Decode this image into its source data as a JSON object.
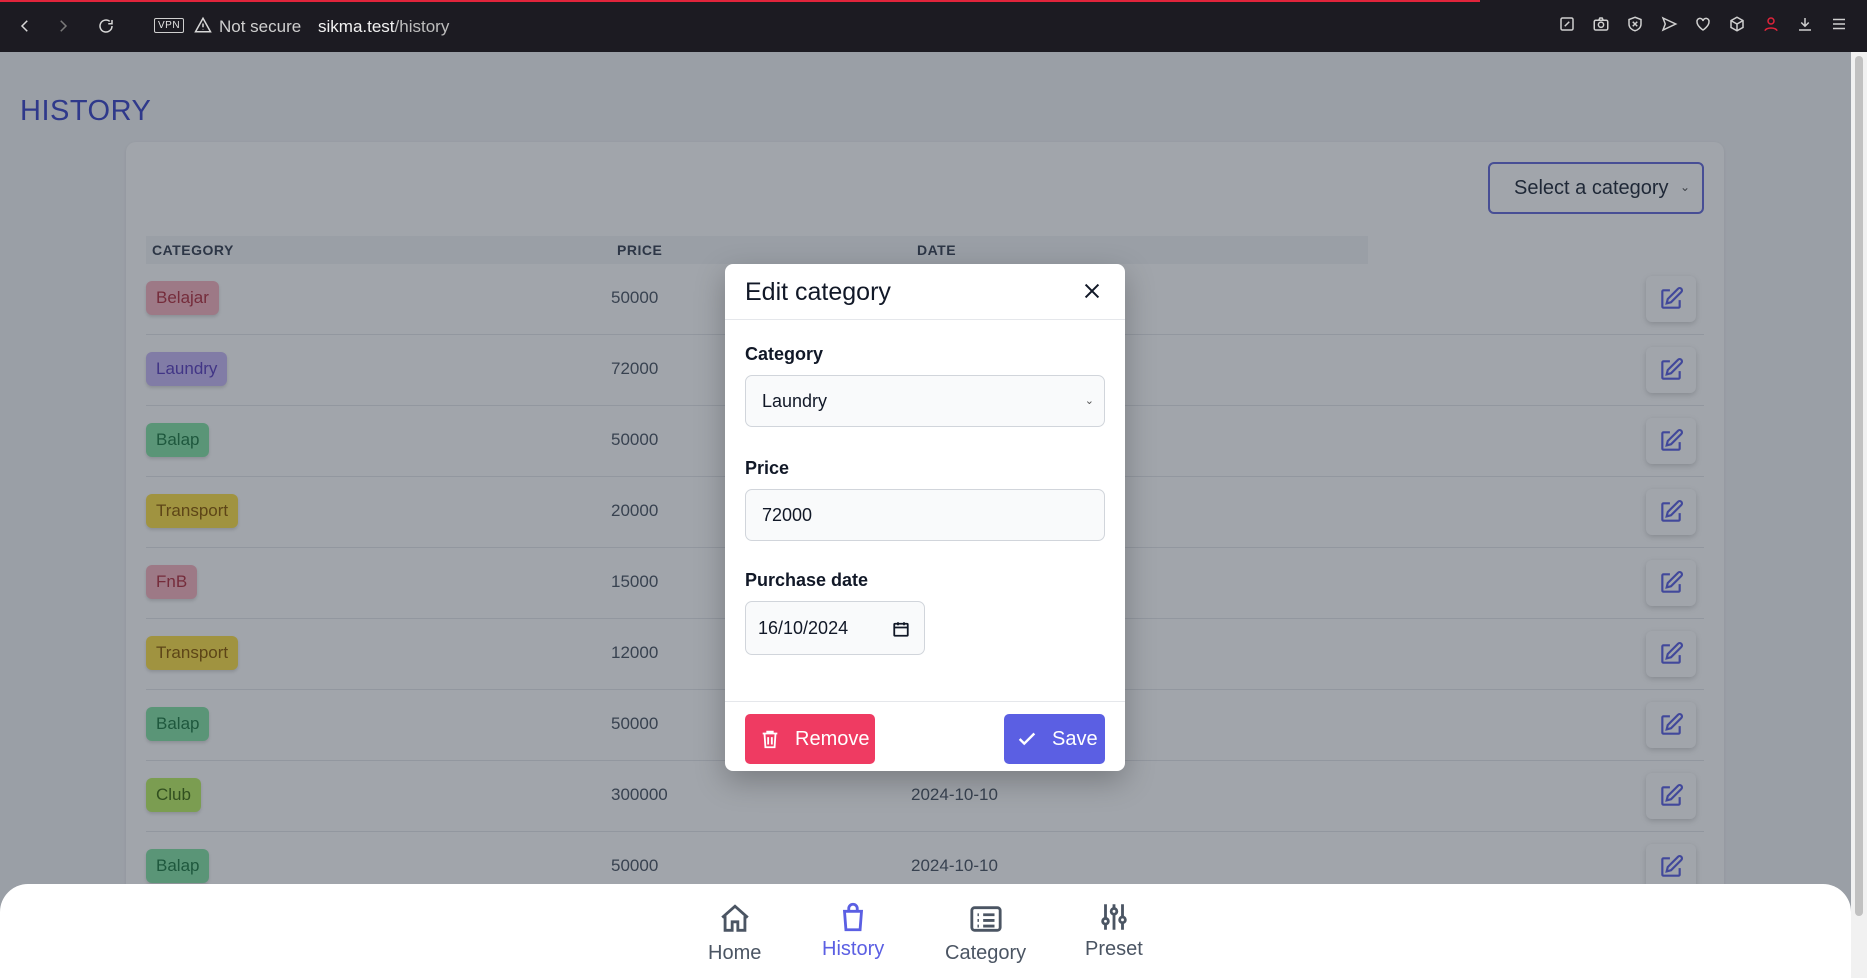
{
  "browser": {
    "vpn_label": "VPN",
    "security_label": "Not secure",
    "url_host": "sikma.test",
    "url_path": "/history"
  },
  "page": {
    "title": "HISTORY",
    "filter_select": "Select a category"
  },
  "table": {
    "headers": [
      "CATEGORY",
      "PRICE",
      "DATE"
    ],
    "rows": [
      {
        "category": "Belajar",
        "price": "50000",
        "date": "",
        "color": "#f9b4c0",
        "text_color": "#b4303f"
      },
      {
        "category": "Laundry",
        "price": "72000",
        "date": "",
        "color": "#c9b9f6",
        "text_color": "#5b3fc0"
      },
      {
        "category": "Balap",
        "price": "50000",
        "date": "",
        "color": "#86e3a6",
        "text_color": "#1e7a43"
      },
      {
        "category": "Transport",
        "price": "20000",
        "date": "",
        "color": "#fde047",
        "text_color": "#8a5a00"
      },
      {
        "category": "FnB",
        "price": "15000",
        "date": "",
        "color": "#f9b4c0",
        "text_color": "#b4303f"
      },
      {
        "category": "Transport",
        "price": "12000",
        "date": "",
        "color": "#fde047",
        "text_color": "#8a5a00"
      },
      {
        "category": "Balap",
        "price": "50000",
        "date": "",
        "color": "#86e3a6",
        "text_color": "#1e7a43"
      },
      {
        "category": "Club",
        "price": "300000",
        "date": "2024-10-10",
        "color": "#bef264",
        "text_color": "#3f6b0f"
      },
      {
        "category": "Balap",
        "price": "50000",
        "date": "2024-10-10",
        "color": "#86e3a6",
        "text_color": "#1e7a43"
      }
    ]
  },
  "modal": {
    "title": "Edit category",
    "category_label": "Category",
    "category_value": "Laundry",
    "price_label": "Price",
    "price_value": "72000",
    "date_label": "Purchase date",
    "date_value": "16/10/2024",
    "remove_label": "Remove",
    "save_label": "Save"
  },
  "bottom_nav": {
    "items": [
      {
        "label": "Home",
        "icon": "home-icon",
        "active": false
      },
      {
        "label": "History",
        "icon": "shopping-bag-icon",
        "active": true
      },
      {
        "label": "Category",
        "icon": "list-icon",
        "active": false
      },
      {
        "label": "Preset",
        "icon": "sliders-icon",
        "active": false
      }
    ]
  },
  "colors": {
    "accent": "#5b5fe3",
    "danger": "#ef3b62",
    "title": "#3b45c9"
  }
}
